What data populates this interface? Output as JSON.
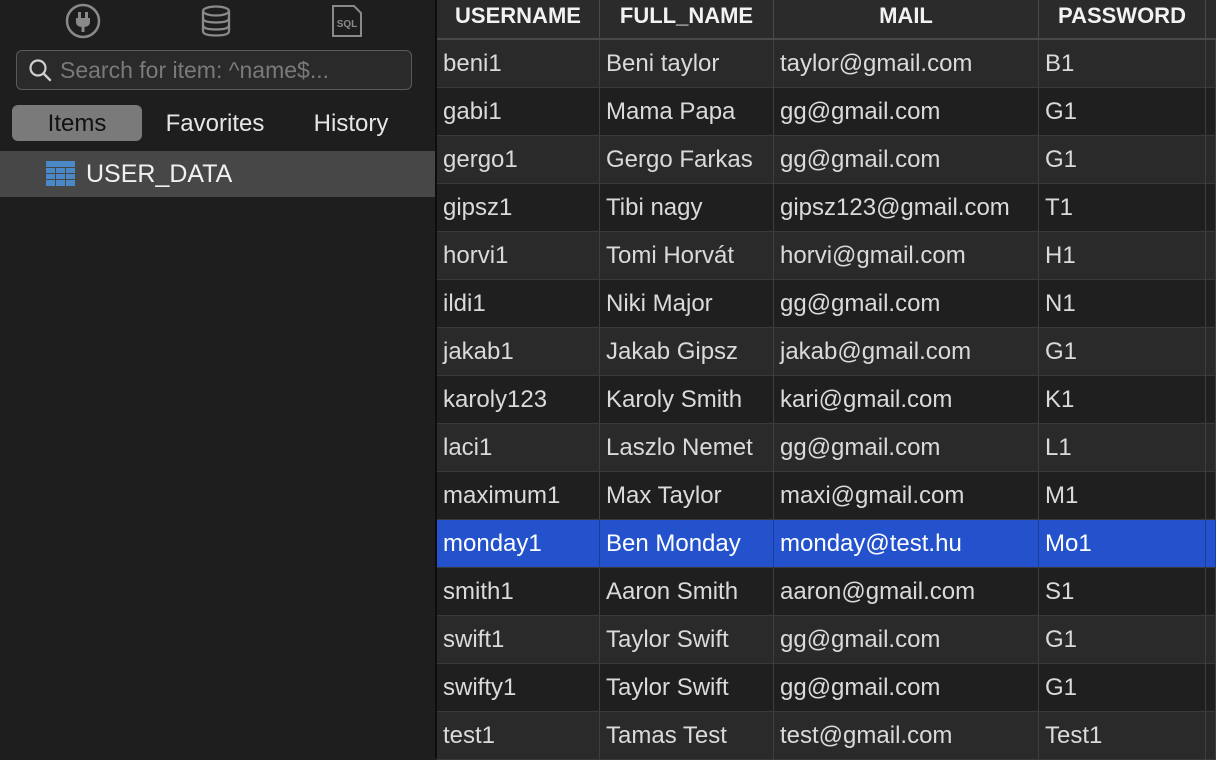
{
  "sidebar": {
    "toolbar_icons": [
      "plug-icon",
      "database-icon",
      "sql-icon"
    ],
    "sql_icon_label": "SQL",
    "search": {
      "placeholder": "Search for item: ^name$...",
      "value": ""
    },
    "tabs": [
      {
        "label": "Items",
        "active": true
      },
      {
        "label": "Favorites",
        "active": false
      },
      {
        "label": "History",
        "active": false
      }
    ],
    "tree": {
      "selected_item": "USER_DATA"
    }
  },
  "grid": {
    "columns": [
      "USERNAME",
      "FULL_NAME",
      "MAIL",
      "PASSWORD"
    ],
    "rows": [
      {
        "username": "beni1",
        "full_name": "Beni taylor",
        "mail": "taylor@gmail.com",
        "password": "B1"
      },
      {
        "username": "gabi1",
        "full_name": "Mama Papa",
        "mail": "gg@gmail.com",
        "password": "G1"
      },
      {
        "username": "gergo1",
        "full_name": "Gergo Farkas",
        "mail": "gg@gmail.com",
        "password": "G1"
      },
      {
        "username": "gipsz1",
        "full_name": "Tibi nagy",
        "mail": "gipsz123@gmail.com",
        "password": "T1"
      },
      {
        "username": "horvi1",
        "full_name": "Tomi Horvát",
        "mail": "horvi@gmail.com",
        "password": "H1"
      },
      {
        "username": "ildi1",
        "full_name": "Niki Major",
        "mail": "gg@gmail.com",
        "password": "N1"
      },
      {
        "username": "jakab1",
        "full_name": "Jakab Gipsz",
        "mail": "jakab@gmail.com",
        "password": "G1"
      },
      {
        "username": "karoly123",
        "full_name": "Karoly Smith",
        "mail": "kari@gmail.com",
        "password": "K1"
      },
      {
        "username": "laci1",
        "full_name": "Laszlo Nemet",
        "mail": "gg@gmail.com",
        "password": "L1"
      },
      {
        "username": "maximum1",
        "full_name": "Max Taylor",
        "mail": "maxi@gmail.com",
        "password": "M1"
      },
      {
        "username": "monday1",
        "full_name": "Ben Monday",
        "mail": "monday@test.hu",
        "password": "Mo1"
      },
      {
        "username": "smith1",
        "full_name": "Aaron Smith",
        "mail": "aaron@gmail.com",
        "password": "S1"
      },
      {
        "username": "swift1",
        "full_name": "Taylor Swift",
        "mail": "gg@gmail.com",
        "password": "G1"
      },
      {
        "username": "swifty1",
        "full_name": "Taylor Swift",
        "mail": "gg@gmail.com",
        "password": "G1"
      },
      {
        "username": "test1",
        "full_name": "Tamas Test",
        "mail": "test@gmail.com",
        "password": "Test1"
      }
    ],
    "selected_row": 10
  },
  "colors": {
    "selection": "#2452cc",
    "accent_table_icon": "#4a88c7"
  }
}
